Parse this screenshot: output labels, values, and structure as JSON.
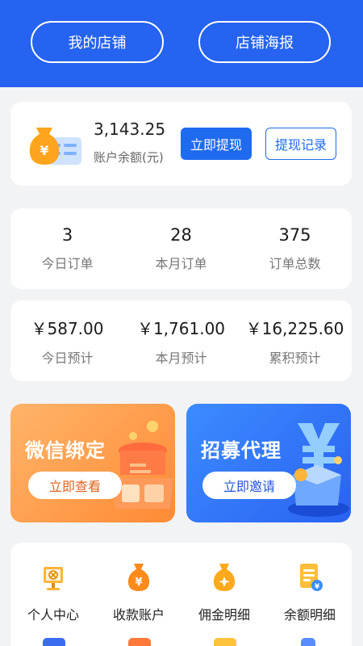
{
  "header": {
    "my_shop": "我的店铺",
    "shop_poster": "店铺海报"
  },
  "balance": {
    "amount": "3,143.25",
    "label": "账户余额(元)",
    "withdraw": "立即提现",
    "withdraw_record": "提现记录"
  },
  "orders": [
    {
      "value": "3",
      "label": "今日订单"
    },
    {
      "value": "28",
      "label": "本月订单"
    },
    {
      "value": "375",
      "label": "订单总数"
    }
  ],
  "earnings": [
    {
      "value": "￥587.00",
      "label": "今日预计"
    },
    {
      "value": "￥1,761.00",
      "label": "本月预计"
    },
    {
      "value": "￥16,225.60",
      "label": "累积预计"
    }
  ],
  "banners": {
    "wechat": {
      "title": "微信绑定",
      "button": "立即查看"
    },
    "agent": {
      "title": "招募代理",
      "button": "立即邀请"
    }
  },
  "menu": [
    {
      "label": "个人中心",
      "icon": "monitor-icon"
    },
    {
      "label": "收款账户",
      "icon": "money-bag-icon"
    },
    {
      "label": "佣金明细",
      "icon": "commission-bag-icon"
    },
    {
      "label": "余额明细",
      "icon": "document-yen-icon"
    }
  ],
  "colors": {
    "primary": "#2563f0",
    "button_blue": "#1f6bf0",
    "orange": "#ff8a34"
  }
}
